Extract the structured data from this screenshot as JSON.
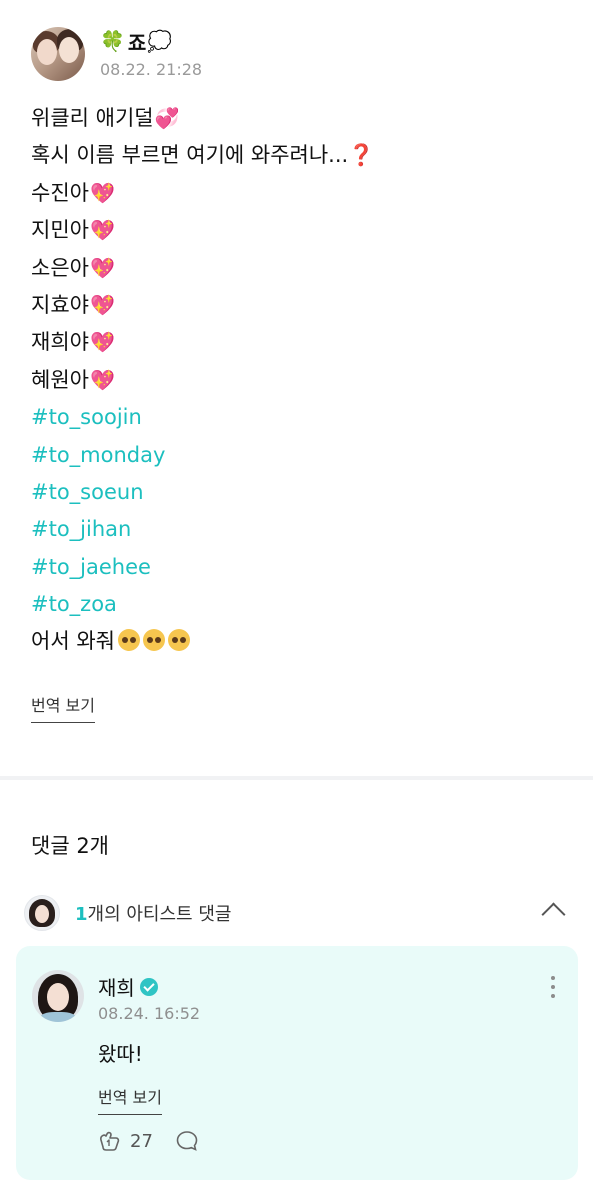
{
  "post": {
    "author_name": "죠",
    "author_prefix_icon": "four-leaf-clover",
    "author_suffix_icon": "thought-balloon",
    "date": "08.22. 21:28",
    "lines": [
      {
        "text": "위클리 애기덜",
        "suffix": "💞"
      },
      {
        "text": "혹시 이름 부르면 여기에 와주려나...",
        "suffix": "❓"
      },
      {
        "text": "수진아",
        "suffix": "💖"
      },
      {
        "text": "지민아",
        "suffix": "💖"
      },
      {
        "text": "소은아",
        "suffix": "💖"
      },
      {
        "text": "지효야",
        "suffix": "💖"
      },
      {
        "text": "재희야",
        "suffix": "💖"
      },
      {
        "text": "혜원아",
        "suffix": "💖"
      }
    ],
    "hashtags": [
      "#to_soojin",
      "#to_monday",
      "#to_soeun",
      "#to_jihan",
      "#to_jaehee",
      "#to_zoa"
    ],
    "closing_text": "어서 와줘",
    "translate_label": "번역 보기"
  },
  "comments": {
    "heading": "댓글 2개",
    "artist_count": "1",
    "artist_label": "개의 아티스트 댓글",
    "items": [
      {
        "author": "재희",
        "verified": true,
        "date": "08.24. 16:52",
        "text": "왔따!",
        "translate_label": "번역 보기",
        "like_count": "27"
      }
    ]
  },
  "colors": {
    "hashtag": "#1cbfbf",
    "comment_card_bg": "#e9fbf9",
    "date_gray": "#9a9a9a",
    "verified": "#2fc4c4"
  }
}
